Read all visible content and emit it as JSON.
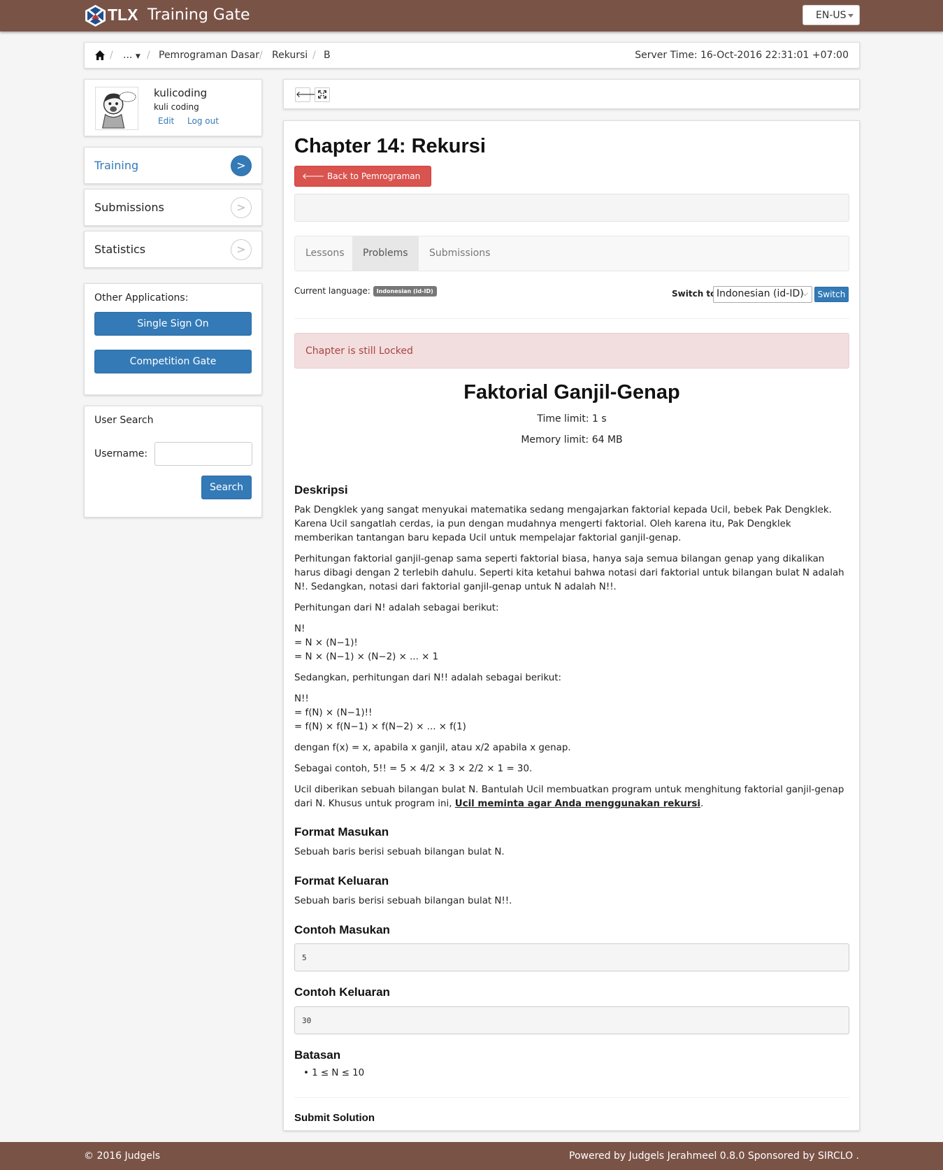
{
  "header": {
    "brand_short": "TLX",
    "brand_name": "Training Gate",
    "language": "EN-US",
    "colors": {
      "bar": "#7a5347",
      "primary": "#337ab7",
      "danger": "#d9534f"
    }
  },
  "breadcrumb": {
    "items": [
      "...",
      "Pemrograman Dasar",
      "Rekursi",
      "B"
    ],
    "server_time": "Server Time: 16-Oct-2016 22:31:01 +07:00"
  },
  "user": {
    "username": "kulicoding",
    "full_name": "kuli coding",
    "edit_label": "Edit",
    "logout_label": "Log out"
  },
  "sidebar": {
    "items": [
      {
        "label": "Training",
        "active": true
      },
      {
        "label": "Submissions",
        "active": false
      },
      {
        "label": "Statistics",
        "active": false
      }
    ],
    "other_title": "Other Applications:",
    "apps": [
      "Single Sign On",
      "Competition Gate"
    ],
    "search_title": "User Search",
    "username_label": "Username:",
    "username_value": "",
    "search_button": "Search"
  },
  "chapter": {
    "title": "Chapter 14: Rekursi",
    "back_label": "Back to Pemrograman Dasar",
    "tabs": [
      {
        "label": "Lessons",
        "active": false
      },
      {
        "label": "Problems",
        "active": true
      },
      {
        "label": "Submissions",
        "active": false
      }
    ],
    "current_language_label": "Current language:",
    "current_language": "Indonesian (id-ID)",
    "switch_label": "Switch to",
    "switch_selected": "Indonesian (id-ID)",
    "switch_button": "Switch",
    "locked_message": "Chapter is still Locked"
  },
  "problem": {
    "title": "Faktorial Ganjil-Genap",
    "time_limit": "Time limit: 1 s",
    "memory_limit": "Memory limit: 64 MB",
    "desc_heading": "Deskripsi",
    "desc_p1": "Pak Dengklek yang sangat menyukai matematika sedang mengajarkan faktorial kepada Ucil, bebek Pak Dengklek. Karena Ucil sangatlah cerdas, ia pun dengan mudahnya mengerti faktorial. Oleh karena itu, Pak Dengklek memberikan tantangan baru kepada Ucil untuk mempelajar faktorial ganjil-genap.",
    "desc_p2": "Perhitungan faktorial ganjil-genap sama seperti faktorial biasa, hanya saja semua bilangan genap yang dikalikan harus dibagi dengan 2 terlebih dahulu. Seperti kita ketahui bahwa notasi dari faktorial untuk bilangan bulat N adalah N!. Sedangkan, notasi dari faktorial ganjil-genap untuk N adalah N!!.",
    "desc_p3": "Perhitungan dari N! adalah sebagai berikut:",
    "formula1": [
      "N!",
      "= N × (N−1)!",
      "= N × (N−1) × (N−2) × ... × 1"
    ],
    "desc_p4": "Sedangkan, perhitungan dari N!! adalah sebagai berikut:",
    "formula2": [
      "N!!",
      "= f(N) × (N−1)!!",
      "= f(N) × f(N−1) × f(N−2) × ... × f(1)"
    ],
    "desc_p5": "dengan f(x) = x, apabila x ganjil, atau x/2 apabila x genap.",
    "desc_p6": "Sebagai contoh, 5!! = 5 × 4/2 × 3 × 2/2 × 1 = 30.",
    "desc_p7": "Ucil diberikan sebuah bilangan bulat N. Bantulah Ucil membuatkan program untuk menghitung faktorial ganjil-genap dari N. Khusus untuk program ini,",
    "desc_p7_emph": "Ucil meminta agar Anda menggunakan rekursi",
    "input_heading": "Format Masukan",
    "input_text": "Sebuah baris berisi sebuah bilangan bulat N.",
    "output_heading": "Format Keluaran",
    "output_text": "Sebuah baris berisi sebuah bilangan bulat N!!.",
    "sample_in_heading": "Contoh Masukan",
    "sample_in": "5",
    "sample_out_heading": "Contoh Keluaran",
    "sample_out": "30",
    "constraints_heading": "Batasan",
    "constraints": [
      "1 ≤ N ≤ 10"
    ],
    "submit_heading": "Submit Solution"
  },
  "footer": {
    "left": "© 2016 Judgels",
    "right": "Powered by Judgels Jerahmeel 0.8.0 Sponsored by SIRCLO ."
  }
}
